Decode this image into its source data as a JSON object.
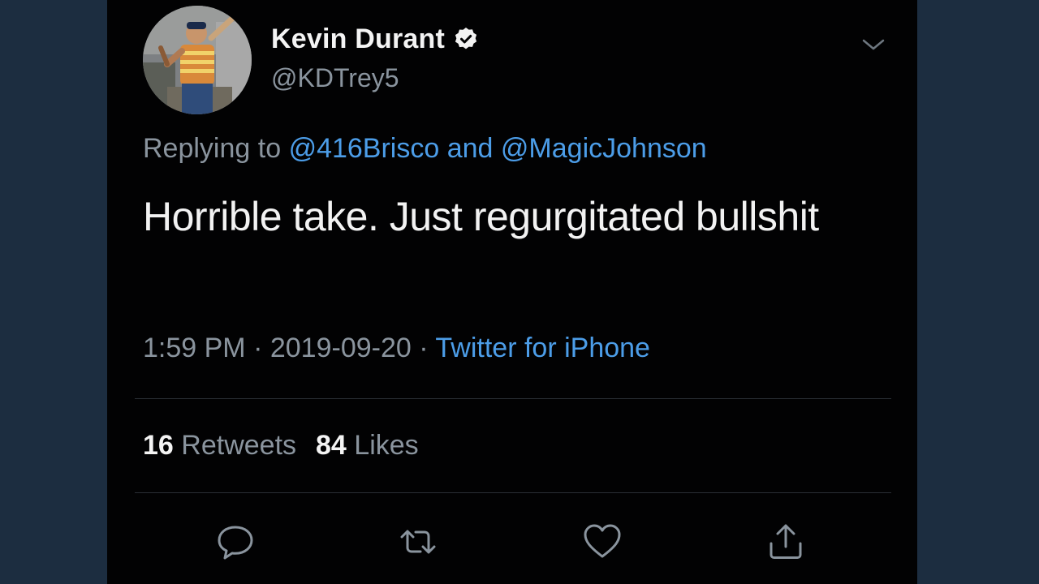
{
  "colors": {
    "background": "#1c2d40",
    "card": "#020203",
    "text": "#f2f2f2",
    "secondary_text": "#8a949e",
    "link": "#4c9de8"
  },
  "author": {
    "display_name": "Kevin Durant",
    "handle": "@KDTrey5",
    "verified_icon": "verified-badge-icon",
    "menu_icon": "chevron-down-icon"
  },
  "reply": {
    "prefix": "Replying to",
    "mention_1": "@416Brisco",
    "connector": "and",
    "mention_2": "@MagicJohnson"
  },
  "tweet": {
    "text": "Horrible take. Just regurgitated bullshit"
  },
  "meta": {
    "time": "1:59 PM",
    "separator": "·",
    "date": "2019-09-20",
    "source": "Twitter for iPhone"
  },
  "stats": {
    "retweets_count": "16",
    "retweets_label": "Retweets",
    "likes_count": "84",
    "likes_label": "Likes"
  },
  "actions": [
    {
      "name": "reply",
      "icon": "speech-bubble-icon"
    },
    {
      "name": "retweet",
      "icon": "retweet-icon"
    },
    {
      "name": "like",
      "icon": "heart-icon"
    },
    {
      "name": "share",
      "icon": "share-icon"
    }
  ]
}
